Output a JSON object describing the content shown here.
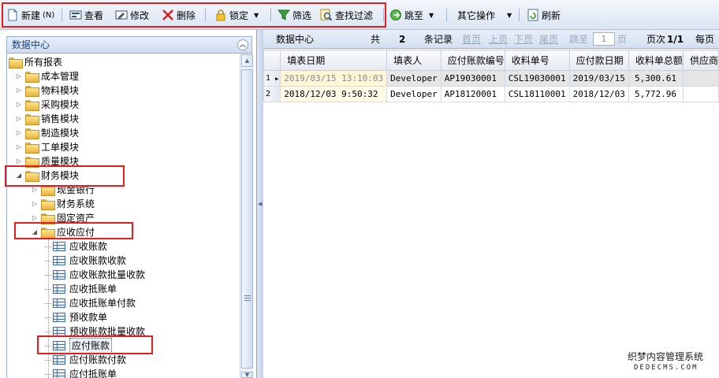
{
  "toolbar": {
    "new": "新建",
    "new_shortcut": "(N)",
    "view": "查看",
    "edit": "修改",
    "delete": "删除",
    "lock": "锁定",
    "filter": "筛选",
    "find_filter": "查找过滤",
    "jump": "跳至",
    "other_ops": "其它操作",
    "refresh": "刷新",
    "icons": [
      "new-doc-icon",
      "view-icon",
      "edit-icon",
      "delete-x-icon",
      "lock-icon",
      "filter-funnel-icon",
      "find-filter-icon",
      "jump-icon",
      "refresh-icon"
    ]
  },
  "left_panel": {
    "title": "数据中心",
    "tree": [
      {
        "label": "所有报表",
        "level": 0,
        "expanded": true
      },
      {
        "label": "成本管理",
        "level": 1,
        "expanded": false
      },
      {
        "label": "物料模块",
        "level": 1,
        "expanded": false
      },
      {
        "label": "采购模块",
        "level": 1,
        "expanded": false
      },
      {
        "label": "销售模块",
        "level": 1,
        "expanded": false
      },
      {
        "label": "制造模块",
        "level": 1,
        "expanded": false
      },
      {
        "label": "工单模块",
        "level": 1,
        "expanded": false
      },
      {
        "label": "质量模块",
        "level": 1,
        "expanded": false
      },
      {
        "label": "财务模块",
        "level": 1,
        "expanded": true
      },
      {
        "label": "现金银行",
        "level": 2,
        "expanded": false
      },
      {
        "label": "财务系统",
        "level": 2,
        "expanded": false
      },
      {
        "label": "固定资产",
        "level": 2,
        "expanded": false
      },
      {
        "label": "应收应付",
        "level": 2,
        "expanded": true
      },
      {
        "label": "应收账款",
        "level": 3
      },
      {
        "label": "应收账款收款",
        "level": 3
      },
      {
        "label": "应收账款批量收款",
        "level": 3
      },
      {
        "label": "应收抵账单",
        "level": 3
      },
      {
        "label": "应收抵账单付款",
        "level": 3
      },
      {
        "label": "预收款单",
        "level": 3
      },
      {
        "label": "预收账款批量收款",
        "level": 3
      },
      {
        "label": "应付账款",
        "level": 3,
        "selected": true
      },
      {
        "label": "应付账款付款",
        "level": 3
      },
      {
        "label": "应付抵账单",
        "level": 3
      }
    ]
  },
  "pager": {
    "title": "数据中心",
    "total_prefix": "共",
    "total": "2",
    "records_suffix": "条记录",
    "first": "首页",
    "prev": "上页",
    "next": "下页",
    "last": "尾页",
    "jump": "跳至",
    "page_input": "1",
    "page_unit": "页",
    "page_info_label": "页次",
    "page_info": "1/1",
    "per_page": "每页"
  },
  "grid": {
    "columns": [
      "填表日期",
      "填表人",
      "应付账款编号",
      "收料单号",
      "应付款日期",
      "收料单总额",
      "供应商"
    ],
    "rows": [
      {
        "index": "1",
        "date": "2019/03/15 13:10:03",
        "user": "Developer",
        "ap_no": "AP19030001",
        "receipt_no": "CSL19030001",
        "due_date": "2019/03/15",
        "amount": "5,300.61",
        "supplier": ""
      },
      {
        "index": "2",
        "date": "2018/12/03 9:50:32",
        "user": "Developer",
        "ap_no": "AP18120001",
        "receipt_no": "CSL18110001",
        "due_date": "2018/12/03",
        "amount": "5,772.96",
        "supplier": ""
      }
    ]
  },
  "watermark": {
    "line1": "织梦内容管理系统",
    "line2": "DEDECMS.COM"
  },
  "colors": {
    "highlight_box": "#e02020",
    "header_text": "#15428b",
    "selected_date_bg": "#fef6d6"
  }
}
